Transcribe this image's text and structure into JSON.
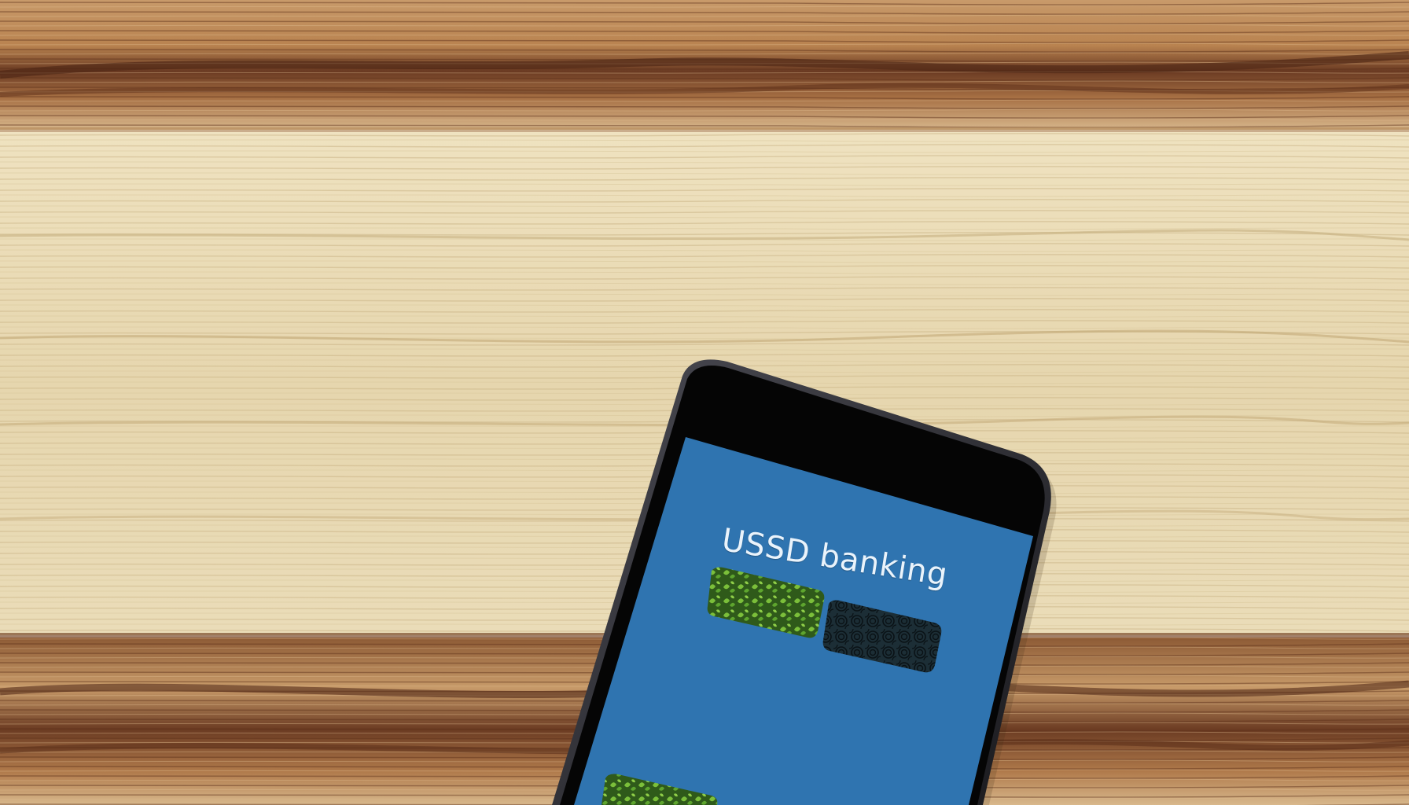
{
  "phone": {
    "screen_title": "USSD banking",
    "screen_color": "#2f74b0",
    "bezel_color": "#050505"
  },
  "background": {
    "surface": "wood-table",
    "colors": {
      "light_wood": "#e6d7b2",
      "dark_wood": "#7a4a2c"
    }
  }
}
